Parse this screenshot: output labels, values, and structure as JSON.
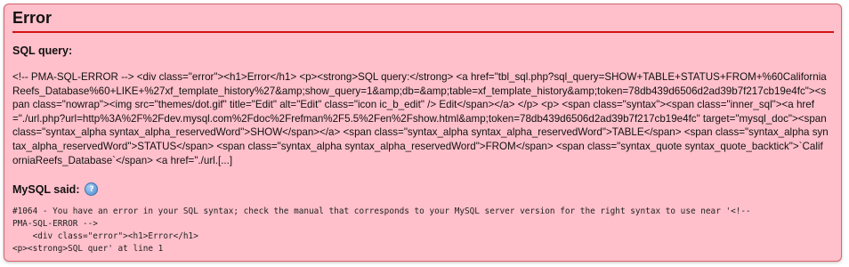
{
  "error": {
    "title": "Error",
    "sql_query_label": "SQL query:",
    "sql_query_text": "<!-- PMA-SQL-ERROR --> <div class=\"error\"><h1>Error</h1> <p><strong>SQL query:</strong> <a href=\"tbl_sql.php?sql_query=SHOW+TABLE+STATUS+FROM+%60CaliforniaReefs_Database%60+LIKE+%27xf_template_history%27&amp;show_query=1&amp;db=&amp;table=xf_template_history&amp;token=78db439d6506d2ad39b7f217cb19e4fc\"><span class=\"nowrap\"><img src=\"themes/dot.gif\" title=\"Edit\" alt=\"Edit\" class=\"icon ic_b_edit\" /> Edit</span></a> </p> <p> <span class=\"syntax\"><span class=\"inner_sql\"><a href=\"./url.php?url=http%3A%2F%2Fdev.mysql.com%2Fdoc%2Frefman%2F5.5%2Fen%2Fshow.html&amp;token=78db439d6506d2ad39b7f217cb19e4fc\" target=\"mysql_doc\"><span class=\"syntax_alpha syntax_alpha_reservedWord\">SHOW</span></a> <span class=\"syntax_alpha syntax_alpha_reservedWord\">TABLE</span> <span class=\"syntax_alpha syntax_alpha_reservedWord\">STATUS</span> <span class=\"syntax_alpha syntax_alpha_reservedWord\">FROM</span> <span class=\"syntax_quote syntax_quote_backtick\">`CaliforniaReefs_Database`</span> <a href=\"./url.[...]",
    "mysql_said_label": "MySQL said:",
    "help_icon": "help-icon",
    "mysql_error_text": "#1064 - You have an error in your SQL syntax; check the manual that corresponds to your MySQL server version for the right syntax to use near '<!--\nPMA-SQL-ERROR -->\n    <div class=\"error\"><h1>Error</h1>\n<p><strong>SQL quer' at line 1"
  },
  "colors": {
    "background": "#ffc0cb",
    "border": "#d9646f",
    "title_rule": "#d21414"
  }
}
